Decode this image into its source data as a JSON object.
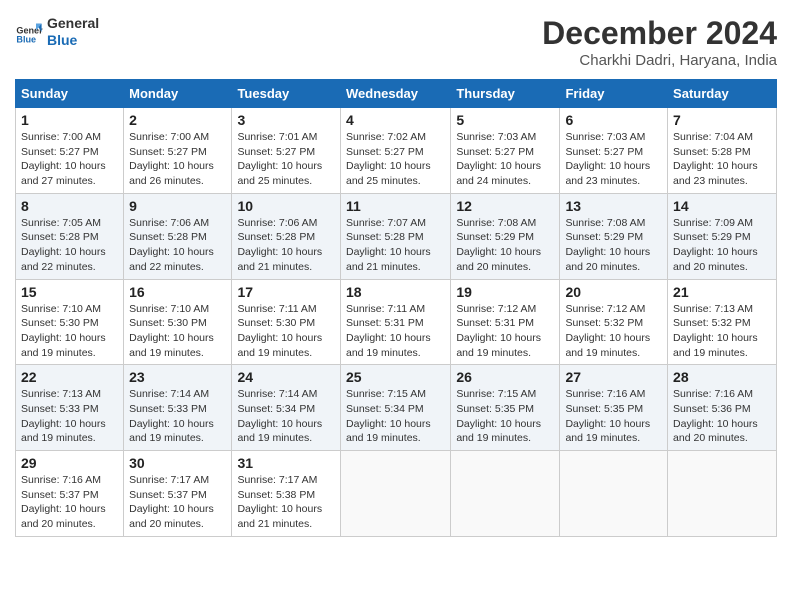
{
  "logo": {
    "line1": "General",
    "line2": "Blue"
  },
  "title": "December 2024",
  "location": "Charkhi Dadri, Haryana, India",
  "days_of_week": [
    "Sunday",
    "Monday",
    "Tuesday",
    "Wednesday",
    "Thursday",
    "Friday",
    "Saturday"
  ],
  "weeks": [
    [
      {
        "day": "1",
        "sunrise": "Sunrise: 7:00 AM",
        "sunset": "Sunset: 5:27 PM",
        "daylight": "Daylight: 10 hours and 27 minutes."
      },
      {
        "day": "2",
        "sunrise": "Sunrise: 7:00 AM",
        "sunset": "Sunset: 5:27 PM",
        "daylight": "Daylight: 10 hours and 26 minutes."
      },
      {
        "day": "3",
        "sunrise": "Sunrise: 7:01 AM",
        "sunset": "Sunset: 5:27 PM",
        "daylight": "Daylight: 10 hours and 25 minutes."
      },
      {
        "day": "4",
        "sunrise": "Sunrise: 7:02 AM",
        "sunset": "Sunset: 5:27 PM",
        "daylight": "Daylight: 10 hours and 25 minutes."
      },
      {
        "day": "5",
        "sunrise": "Sunrise: 7:03 AM",
        "sunset": "Sunset: 5:27 PM",
        "daylight": "Daylight: 10 hours and 24 minutes."
      },
      {
        "day": "6",
        "sunrise": "Sunrise: 7:03 AM",
        "sunset": "Sunset: 5:27 PM",
        "daylight": "Daylight: 10 hours and 23 minutes."
      },
      {
        "day": "7",
        "sunrise": "Sunrise: 7:04 AM",
        "sunset": "Sunset: 5:28 PM",
        "daylight": "Daylight: 10 hours and 23 minutes."
      }
    ],
    [
      {
        "day": "8",
        "sunrise": "Sunrise: 7:05 AM",
        "sunset": "Sunset: 5:28 PM",
        "daylight": "Daylight: 10 hours and 22 minutes."
      },
      {
        "day": "9",
        "sunrise": "Sunrise: 7:06 AM",
        "sunset": "Sunset: 5:28 PM",
        "daylight": "Daylight: 10 hours and 22 minutes."
      },
      {
        "day": "10",
        "sunrise": "Sunrise: 7:06 AM",
        "sunset": "Sunset: 5:28 PM",
        "daylight": "Daylight: 10 hours and 21 minutes."
      },
      {
        "day": "11",
        "sunrise": "Sunrise: 7:07 AM",
        "sunset": "Sunset: 5:28 PM",
        "daylight": "Daylight: 10 hours and 21 minutes."
      },
      {
        "day": "12",
        "sunrise": "Sunrise: 7:08 AM",
        "sunset": "Sunset: 5:29 PM",
        "daylight": "Daylight: 10 hours and 20 minutes."
      },
      {
        "day": "13",
        "sunrise": "Sunrise: 7:08 AM",
        "sunset": "Sunset: 5:29 PM",
        "daylight": "Daylight: 10 hours and 20 minutes."
      },
      {
        "day": "14",
        "sunrise": "Sunrise: 7:09 AM",
        "sunset": "Sunset: 5:29 PM",
        "daylight": "Daylight: 10 hours and 20 minutes."
      }
    ],
    [
      {
        "day": "15",
        "sunrise": "Sunrise: 7:10 AM",
        "sunset": "Sunset: 5:30 PM",
        "daylight": "Daylight: 10 hours and 19 minutes."
      },
      {
        "day": "16",
        "sunrise": "Sunrise: 7:10 AM",
        "sunset": "Sunset: 5:30 PM",
        "daylight": "Daylight: 10 hours and 19 minutes."
      },
      {
        "day": "17",
        "sunrise": "Sunrise: 7:11 AM",
        "sunset": "Sunset: 5:30 PM",
        "daylight": "Daylight: 10 hours and 19 minutes."
      },
      {
        "day": "18",
        "sunrise": "Sunrise: 7:11 AM",
        "sunset": "Sunset: 5:31 PM",
        "daylight": "Daylight: 10 hours and 19 minutes."
      },
      {
        "day": "19",
        "sunrise": "Sunrise: 7:12 AM",
        "sunset": "Sunset: 5:31 PM",
        "daylight": "Daylight: 10 hours and 19 minutes."
      },
      {
        "day": "20",
        "sunrise": "Sunrise: 7:12 AM",
        "sunset": "Sunset: 5:32 PM",
        "daylight": "Daylight: 10 hours and 19 minutes."
      },
      {
        "day": "21",
        "sunrise": "Sunrise: 7:13 AM",
        "sunset": "Sunset: 5:32 PM",
        "daylight": "Daylight: 10 hours and 19 minutes."
      }
    ],
    [
      {
        "day": "22",
        "sunrise": "Sunrise: 7:13 AM",
        "sunset": "Sunset: 5:33 PM",
        "daylight": "Daylight: 10 hours and 19 minutes."
      },
      {
        "day": "23",
        "sunrise": "Sunrise: 7:14 AM",
        "sunset": "Sunset: 5:33 PM",
        "daylight": "Daylight: 10 hours and 19 minutes."
      },
      {
        "day": "24",
        "sunrise": "Sunrise: 7:14 AM",
        "sunset": "Sunset: 5:34 PM",
        "daylight": "Daylight: 10 hours and 19 minutes."
      },
      {
        "day": "25",
        "sunrise": "Sunrise: 7:15 AM",
        "sunset": "Sunset: 5:34 PM",
        "daylight": "Daylight: 10 hours and 19 minutes."
      },
      {
        "day": "26",
        "sunrise": "Sunrise: 7:15 AM",
        "sunset": "Sunset: 5:35 PM",
        "daylight": "Daylight: 10 hours and 19 minutes."
      },
      {
        "day": "27",
        "sunrise": "Sunrise: 7:16 AM",
        "sunset": "Sunset: 5:35 PM",
        "daylight": "Daylight: 10 hours and 19 minutes."
      },
      {
        "day": "28",
        "sunrise": "Sunrise: 7:16 AM",
        "sunset": "Sunset: 5:36 PM",
        "daylight": "Daylight: 10 hours and 20 minutes."
      }
    ],
    [
      {
        "day": "29",
        "sunrise": "Sunrise: 7:16 AM",
        "sunset": "Sunset: 5:37 PM",
        "daylight": "Daylight: 10 hours and 20 minutes."
      },
      {
        "day": "30",
        "sunrise": "Sunrise: 7:17 AM",
        "sunset": "Sunset: 5:37 PM",
        "daylight": "Daylight: 10 hours and 20 minutes."
      },
      {
        "day": "31",
        "sunrise": "Sunrise: 7:17 AM",
        "sunset": "Sunset: 5:38 PM",
        "daylight": "Daylight: 10 hours and 21 minutes."
      },
      null,
      null,
      null,
      null
    ]
  ]
}
